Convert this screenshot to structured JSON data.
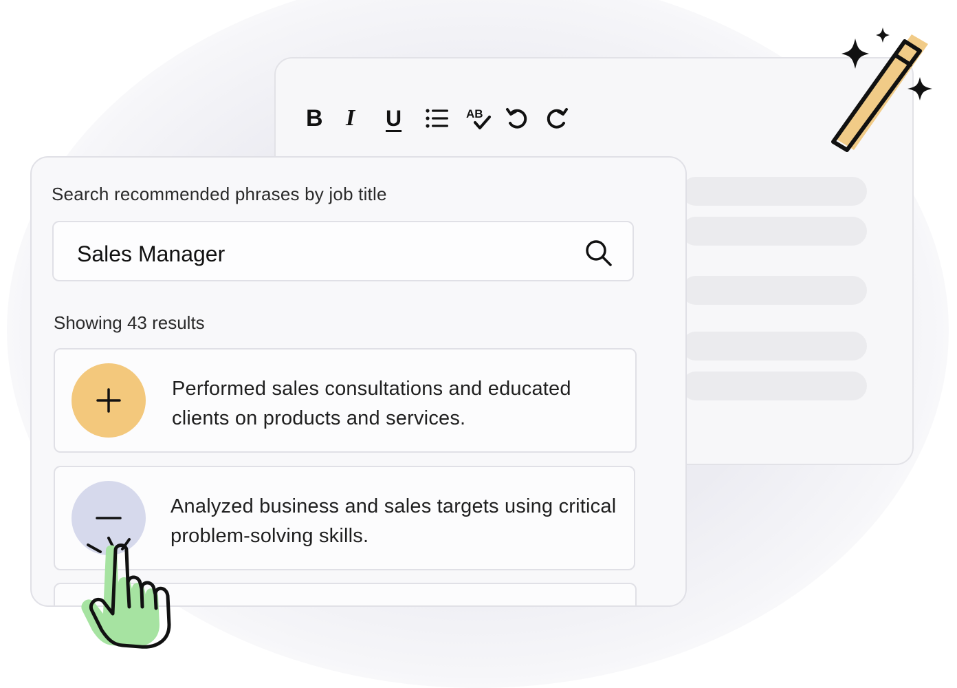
{
  "editor": {
    "toolbar": {
      "bold_label": "B",
      "italic_label": "I",
      "underline_label": "U",
      "tools": [
        "bold",
        "italic",
        "underline",
        "bullet-list",
        "spellcheck",
        "undo",
        "redo"
      ]
    },
    "spellcheck_glyph": "AB"
  },
  "search": {
    "label": "Search recommended phrases by job title",
    "value": "Sales Manager",
    "results_text": "Showing 43 results"
  },
  "results": [
    {
      "text": "Performed sales consultations and educated clients on products and services.",
      "action": "add"
    },
    {
      "text": "Analyzed business and sales targets using critical problem-solving skills.",
      "action": "remove"
    }
  ],
  "colors": {
    "add_button": "#f3c87c",
    "remove_button": "#d6d9ec",
    "wand_accent": "#f0c57a",
    "hand": "#a6e3a1"
  },
  "icons": [
    "search-icon",
    "plus-icon",
    "minus-icon",
    "magic-wand-icon",
    "pointer-hand-icon"
  ]
}
